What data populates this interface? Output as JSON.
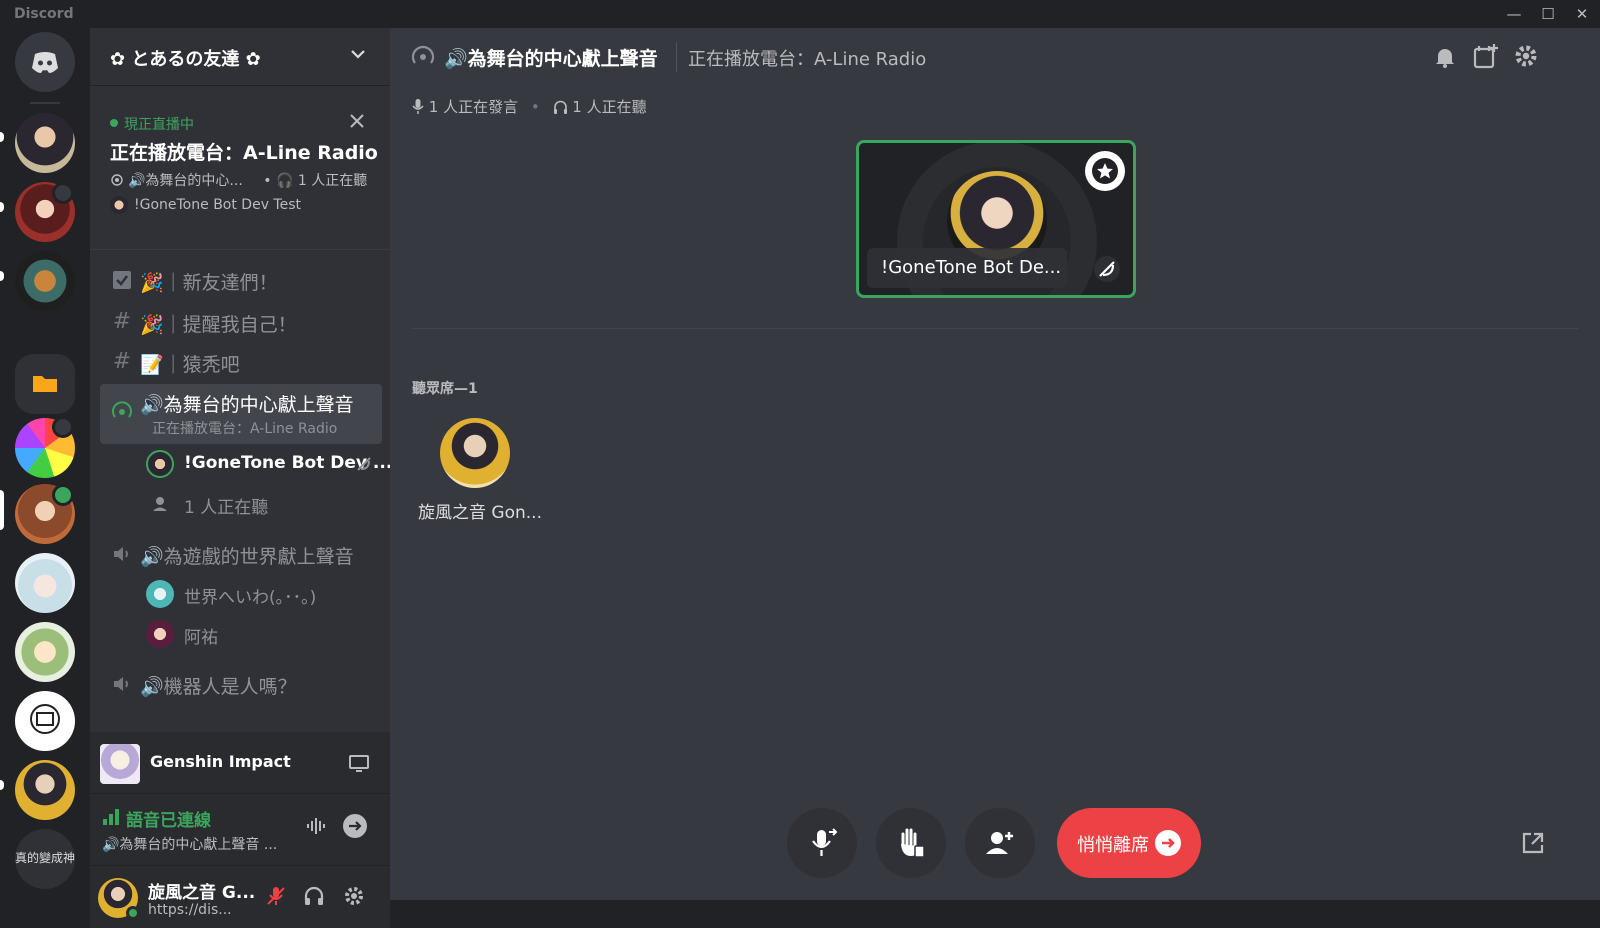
{
  "window": {
    "app_name": "Discord",
    "minimize": "—",
    "maximize": "☐",
    "close": "✕"
  },
  "rail": {
    "servers": [
      {
        "name": "server-avatar-1"
      },
      {
        "name": "server-avatar-2"
      },
      {
        "name": "server-avatar-3"
      },
      {
        "name": "server-avatar-4"
      },
      {
        "name": "server-avatar-5"
      },
      {
        "name": "server-avatar-6"
      },
      {
        "name": "server-avatar-7"
      },
      {
        "name": "server-avatar-8"
      },
      {
        "name": "server-avatar-9"
      }
    ],
    "bottom_label": "真的變成神"
  },
  "guild": {
    "name": "✿ とあるの友達 ✿"
  },
  "live": {
    "status": "現正直播中",
    "title": "正在播放電台：A-Line Radio",
    "channel": "🔊為舞台的中心...",
    "listeners": "• 🎧 1 人正在聽",
    "host": "!GoneTone Bot Dev Test"
  },
  "channels": [
    {
      "label": "🎉｜新友達們！"
    },
    {
      "label": "🎉｜提醒我自己！"
    },
    {
      "label": "📝｜猿秃吧"
    },
    {
      "label": "🔊為舞台的中心獻上聲音",
      "sub": "正在播放電台：A-Line Radio"
    },
    {
      "label": "🔊為遊戲的世界獻上聲音"
    },
    {
      "label": "🔊機器人是人嗎？"
    }
  ],
  "stage_users": [
    {
      "name": "!GoneTone Bot Dev ..."
    },
    {
      "name": "1 人正在聽"
    }
  ],
  "voice_users": [
    {
      "name": "世界へいわ(｡･･｡)"
    },
    {
      "name": "阿祐"
    }
  ],
  "activity": {
    "game": "Genshin Impact"
  },
  "voice_panel": {
    "status": "語音已連線",
    "channel": "🔊為舞台的中心獻上聲音 ..."
  },
  "user_panel": {
    "name": "旋風之音 G...",
    "status": "https://dis..."
  },
  "topbar": {
    "channel": "🔊為舞台的中心獻上聲音",
    "topic": "正在播放電台：A-Line Radio"
  },
  "stats": {
    "speaking": "1 人正在發言",
    "listening": "1 人正在聽"
  },
  "speaker": {
    "name": "!GoneTone Bot De..."
  },
  "audience": {
    "label": "聽眾席—1",
    "users": [
      {
        "name": "旋風之音 Gon..."
      }
    ]
  },
  "controls": {
    "leave_label": "悄悄離席"
  },
  "colors": {
    "accent_green": "#3ba55d",
    "danger": "#ed4245",
    "blurple": "#5865f2"
  }
}
